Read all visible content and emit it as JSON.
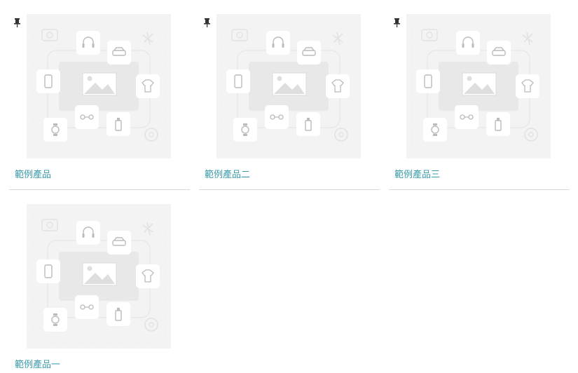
{
  "products": [
    {
      "name": "範例產品",
      "pinned": true
    },
    {
      "name": "範例產品二",
      "pinned": true
    },
    {
      "name": "範例產品三",
      "pinned": true
    },
    {
      "name": "範例產品一",
      "pinned": false
    }
  ],
  "icons": {
    "pin": "pin-icon",
    "placeholder": "image-placeholder-icon"
  },
  "colors": {
    "link": "#3a9aa8",
    "thumb_bg": "#f3f3f3",
    "divider": "#d8d8d8"
  }
}
